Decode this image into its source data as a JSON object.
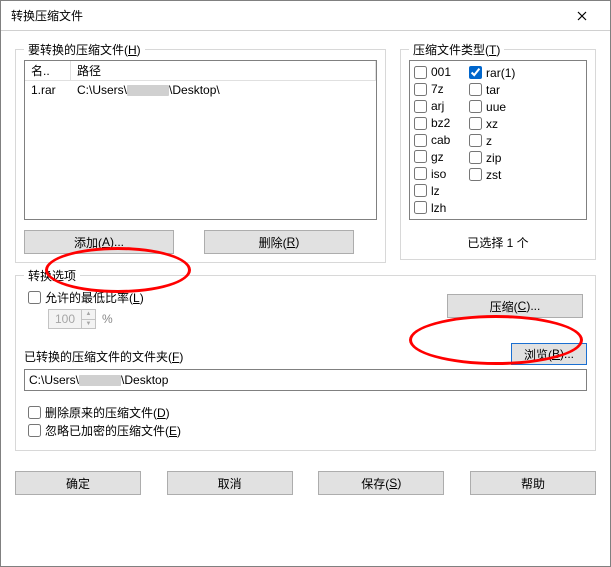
{
  "window": {
    "title": "转换压缩文件"
  },
  "archives": {
    "group_label": "要转换的压缩文件(",
    "group_hotkey": "H",
    "group_suffix": ")",
    "col_name": "名..",
    "col_path": "路径",
    "rows": [
      {
        "name": "1.rar",
        "path_prefix": "C:\\Users\\",
        "path_suffix": "\\Desktop\\"
      }
    ],
    "add_label": "添加(",
    "add_hotkey": "A",
    "add_suffix": ")...",
    "del_label": "删除(",
    "del_hotkey": "R",
    "del_suffix": ")"
  },
  "types": {
    "group_label": "压缩文件类型(",
    "group_hotkey": "T",
    "group_suffix": ")",
    "col1": [
      {
        "label": "001",
        "checked": false
      },
      {
        "label": "7z",
        "checked": false
      },
      {
        "label": "arj",
        "checked": false
      },
      {
        "label": "bz2",
        "checked": false
      },
      {
        "label": "cab",
        "checked": false
      },
      {
        "label": "gz",
        "checked": false
      },
      {
        "label": "iso",
        "checked": false
      },
      {
        "label": "lz",
        "checked": false
      },
      {
        "label": "lzh",
        "checked": false
      }
    ],
    "col2": [
      {
        "label": "rar(1)",
        "checked": true
      },
      {
        "label": "tar",
        "checked": false
      },
      {
        "label": "uue",
        "checked": false
      },
      {
        "label": "xz",
        "checked": false
      },
      {
        "label": "z",
        "checked": false
      },
      {
        "label": "zip",
        "checked": false
      },
      {
        "label": "zst",
        "checked": false
      }
    ],
    "status": "已选择 1 个"
  },
  "options": {
    "group_label": "转换选项",
    "ratio_label": "允许的最低比率(",
    "ratio_hotkey": "L",
    "ratio_suffix": ")",
    "ratio_value": "100",
    "ratio_unit": "%",
    "compress_label": "压缩(",
    "compress_hotkey": "C",
    "compress_suffix": ")...",
    "folder_label": "已转换的压缩文件的文件夹(",
    "folder_hotkey": "F",
    "folder_suffix": ")",
    "browse_label": "浏览(",
    "browse_hotkey": "B",
    "browse_suffix": ")...",
    "folder_value_prefix": "C:\\Users\\",
    "folder_value_suffix": "\\Desktop",
    "delete_orig_label": "删除原来的压缩文件(",
    "delete_orig_hotkey": "D",
    "delete_orig_suffix": ")",
    "ignore_enc_label": "忽略已加密的压缩文件(",
    "ignore_enc_hotkey": "E",
    "ignore_enc_suffix": ")"
  },
  "footer": {
    "ok": "确定",
    "cancel": "取消",
    "save_label": "保存(",
    "save_hotkey": "S",
    "save_suffix": ")",
    "help": "帮助"
  }
}
